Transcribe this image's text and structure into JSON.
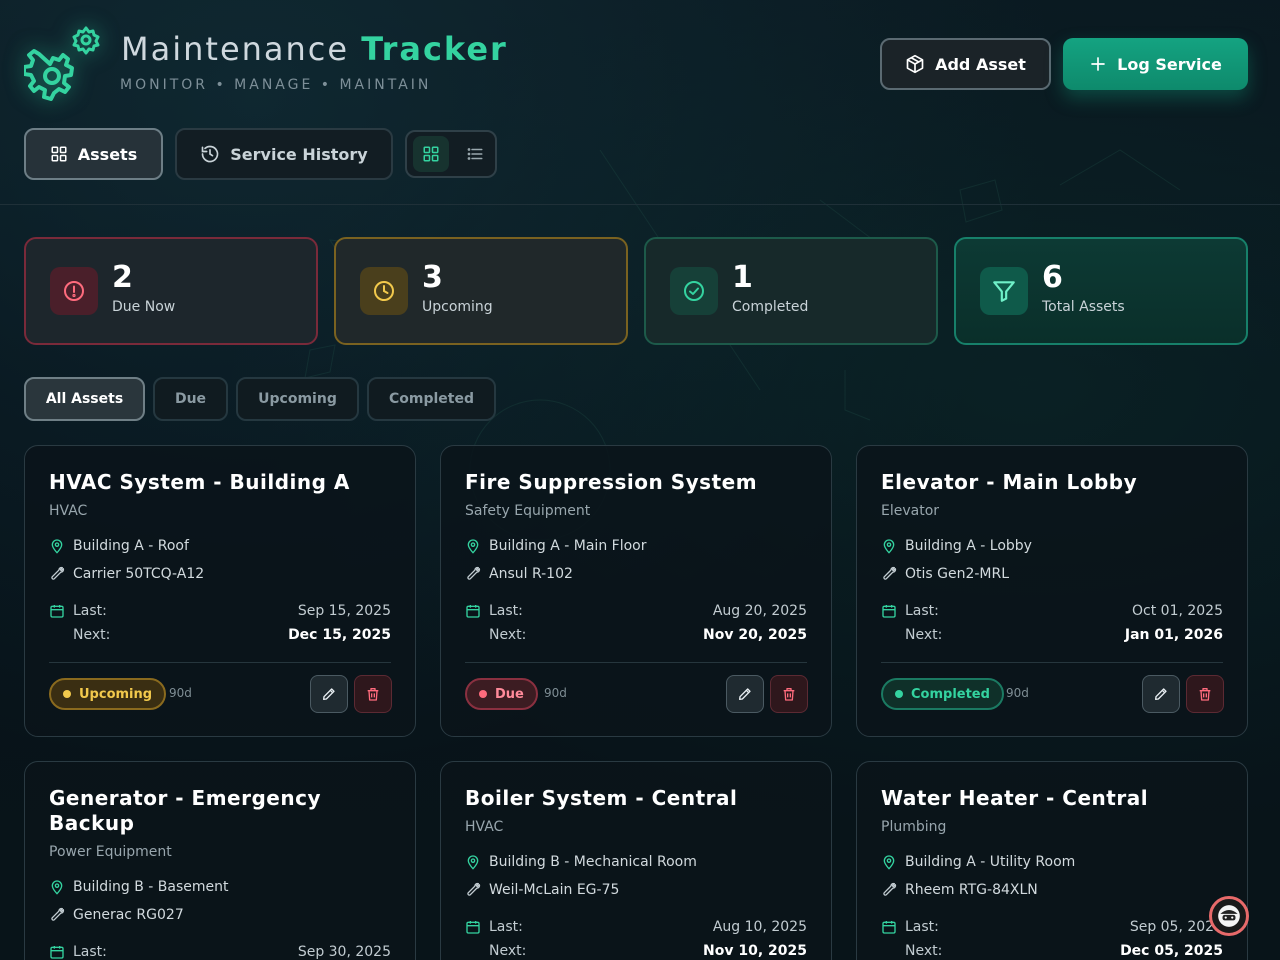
{
  "header": {
    "title_main": "Maintenance",
    "title_accent": "Tracker",
    "subtitle": "MONITOR • MANAGE • MAINTAIN",
    "add_asset_label": "Add Asset",
    "log_service_label": "Log Service"
  },
  "tabs": {
    "assets": "Assets",
    "history": "Service History",
    "view_mode": "grid"
  },
  "stats": [
    {
      "value": "2",
      "label": "Due Now",
      "icon": "alert-circle-icon",
      "color": "#ff6b7d"
    },
    {
      "value": "3",
      "label": "Upcoming",
      "icon": "clock-icon",
      "color": "#f2c94c"
    },
    {
      "value": "1",
      "label": "Completed",
      "icon": "check-circle-icon",
      "color": "#34d3a0"
    },
    {
      "value": "6",
      "label": "Total Assets",
      "icon": "filter-icon",
      "color": "#34d3a0"
    }
  ],
  "filters": {
    "all": "All Assets",
    "due": "Due",
    "upcoming": "Upcoming",
    "completed": "Completed",
    "active": "All Assets"
  },
  "labels": {
    "last": "Last:",
    "next": "Next:"
  },
  "assets": [
    {
      "name": "HVAC System - Building A",
      "category": "HVAC",
      "location": "Building A - Roof",
      "model": "Carrier 50TCQ-A12",
      "last": "Sep 15, 2025",
      "next": "Dec 15, 2025",
      "status": "Upcoming",
      "interval": "90d"
    },
    {
      "name": "Fire Suppression System",
      "category": "Safety Equipment",
      "location": "Building A - Main Floor",
      "model": "Ansul R-102",
      "last": "Aug 20, 2025",
      "next": "Nov 20, 2025",
      "status": "Due",
      "interval": "90d"
    },
    {
      "name": "Elevator - Main Lobby",
      "category": "Elevator",
      "location": "Building A - Lobby",
      "model": "Otis Gen2-MRL",
      "last": "Oct 01, 2025",
      "next": "Jan 01, 2026",
      "status": "Completed",
      "interval": "90d"
    },
    {
      "name": "Generator - Emergency Backup",
      "category": "Power Equipment",
      "location": "Building B - Basement",
      "model": "Generac RG027",
      "last": "Sep 30, 2025",
      "next": ""
    },
    {
      "name": "Boiler System - Central",
      "category": "HVAC",
      "location": "Building B - Mechanical Room",
      "model": "Weil-McLain EG-75",
      "last": "Aug 10, 2025",
      "next": "Nov 10, 2025"
    },
    {
      "name": "Water Heater - Central",
      "category": "Plumbing",
      "location": "Building A - Utility Room",
      "model": "Rheem RTG-84XLN",
      "last": "Sep 05, 2025",
      "next": "Dec 05, 2025"
    }
  ]
}
